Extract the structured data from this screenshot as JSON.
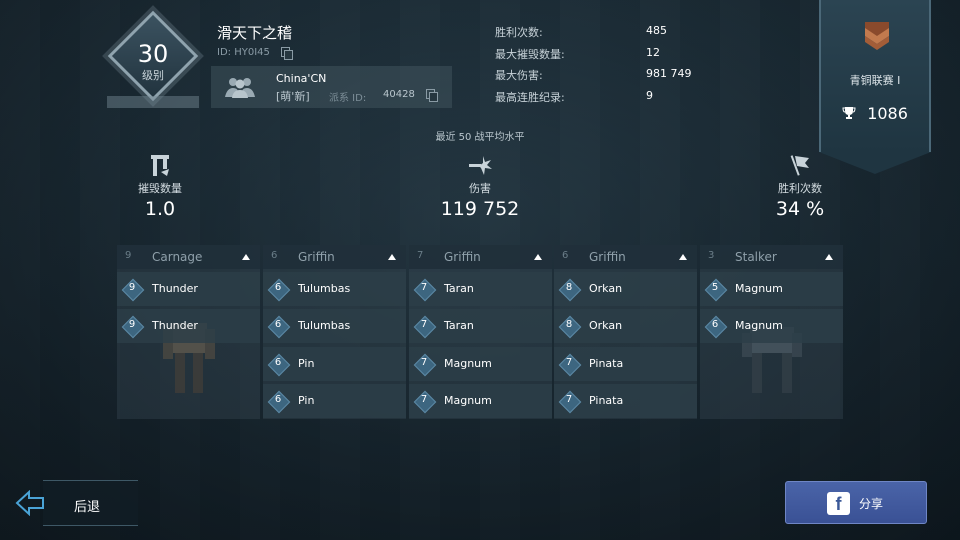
{
  "player": {
    "level": "30",
    "level_label": "级别",
    "name": "滑天下之稽",
    "id": "ID: HY0I45",
    "clan_name": "China'CN",
    "clan_tag": "[萌'新]",
    "clan_id_label": "派系 ID:",
    "clan_id": "40428"
  },
  "stats": [
    {
      "label": "胜利次数:",
      "value": "485"
    },
    {
      "label": "最大摧毁数量:",
      "value": "12"
    },
    {
      "label": "最大伤害:",
      "value": "981 749"
    },
    {
      "label": "最高连胜纪录:",
      "value": "9"
    }
  ],
  "league": {
    "name": "青铜联赛 I",
    "score": "1086",
    "accent": "#b3643e"
  },
  "averages": {
    "title": "最近 50 战平均水平",
    "kills_label": "摧毁数量",
    "kills_value": "1.0",
    "damage_label": "伤害",
    "damage_value": "119 752",
    "wins_label": "胜利次数",
    "wins_value": "34 %"
  },
  "hangars": [
    {
      "level": "9",
      "robot": "Carnage",
      "weapons": [
        {
          "level": "9",
          "name": "Thunder"
        },
        {
          "level": "9",
          "name": "Thunder"
        }
      ]
    },
    {
      "level": "6",
      "robot": "Griffin",
      "weapons": [
        {
          "level": "6",
          "name": "Tulumbas"
        },
        {
          "level": "6",
          "name": "Tulumbas"
        },
        {
          "level": "6",
          "name": "Pin"
        },
        {
          "level": "6",
          "name": "Pin"
        }
      ]
    },
    {
      "level": "7",
      "robot": "Griffin",
      "weapons": [
        {
          "level": "7",
          "name": "Taran"
        },
        {
          "level": "7",
          "name": "Taran"
        },
        {
          "level": "7",
          "name": "Magnum"
        },
        {
          "level": "7",
          "name": "Magnum"
        }
      ]
    },
    {
      "level": "6",
      "robot": "Griffin",
      "weapons": [
        {
          "level": "8",
          "name": "Orkan"
        },
        {
          "level": "8",
          "name": "Orkan"
        },
        {
          "level": "7",
          "name": "Pinata"
        },
        {
          "level": "7",
          "name": "Pinata"
        }
      ]
    },
    {
      "level": "3",
      "robot": "Stalker",
      "weapons": [
        {
          "level": "5",
          "name": "Magnum"
        },
        {
          "level": "6",
          "name": "Magnum"
        }
      ]
    }
  ],
  "buttons": {
    "back": "后退",
    "share": "分享",
    "share_icon": "f"
  },
  "icons": {
    "clan": "group-icon",
    "copy": "copy-icon",
    "trophy": "trophy-icon",
    "kills": "destroy-icon",
    "damage": "damage-burst-icon",
    "wins": "flag-icon",
    "back": "arrow-left-icon",
    "share": "facebook-icon"
  }
}
